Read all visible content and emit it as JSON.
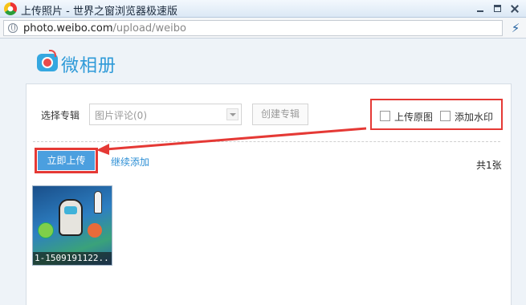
{
  "window": {
    "title": "上传照片 - 世界之窗浏览器极速版"
  },
  "address": {
    "url_domain": "photo.weibo.com",
    "url_path": "/upload/weibo"
  },
  "logo": {
    "text": "微相册"
  },
  "form": {
    "album_label": "选择专辑",
    "album_selected": "图片评论(0)",
    "create_album_label": "创建专辑",
    "option_original_label": "上传原图",
    "option_watermark_label": "添加水印",
    "option_original_checked": false,
    "option_watermark_checked": false
  },
  "actions": {
    "upload_now_label": "立即上传",
    "continue_add_label": "继续添加",
    "total_label": "共1张"
  },
  "photos": [
    {
      "filename": "1-1509191122.."
    }
  ],
  "colors": {
    "accent_blue": "#4b9fdf",
    "link_blue": "#2d8fd5",
    "annotation_red": "#e53935"
  },
  "icons": {
    "app": "browser-logo-icon",
    "address": "globe-icon",
    "speed": "lightning-icon"
  }
}
